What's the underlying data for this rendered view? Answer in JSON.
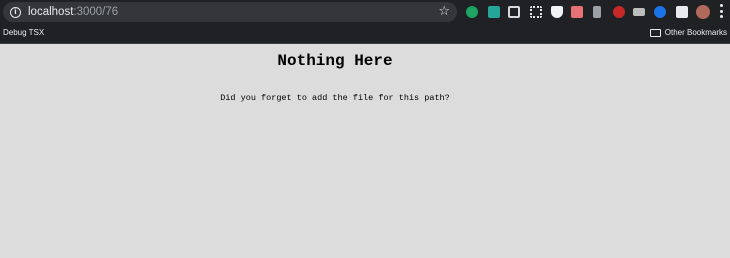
{
  "browser": {
    "url_host": "localhost",
    "url_path": ":3000/76",
    "icons": {
      "info": "info-icon",
      "star": "star-icon",
      "menu": "vertical-dots-icon"
    },
    "extensions": [
      {
        "name": "ext-green-icon",
        "color": "#1ea362"
      },
      {
        "name": "ext-teal-icon",
        "color": "#26a69a"
      },
      {
        "name": "ext-screen-icon",
        "color": "#d9d9d9"
      },
      {
        "name": "ext-ninja-icon",
        "color": "#e8eaed"
      },
      {
        "name": "ext-shield-icon",
        "color": "#f1f3f4"
      },
      {
        "name": "ext-grid-icon",
        "color": "#e57373"
      },
      {
        "name": "ext-bookmark-icon",
        "color": "#9aa0a6"
      },
      {
        "name": "ext-spy-icon",
        "color": "#c62828"
      },
      {
        "name": "ext-hat-icon",
        "color": "#bdbdbd"
      },
      {
        "name": "ext-blue-icon",
        "color": "#1a73e8"
      },
      {
        "name": "ext-puzzle-icon",
        "color": "#e8eaed"
      },
      {
        "name": "profile-avatar",
        "color": "#b06a5a"
      }
    ]
  },
  "bookmarks": {
    "left_label": "Debug TSX",
    "right_label": "Other Bookmarks"
  },
  "page": {
    "title": "Nothing Here",
    "message": "Did you forget to add the file for this path?"
  }
}
